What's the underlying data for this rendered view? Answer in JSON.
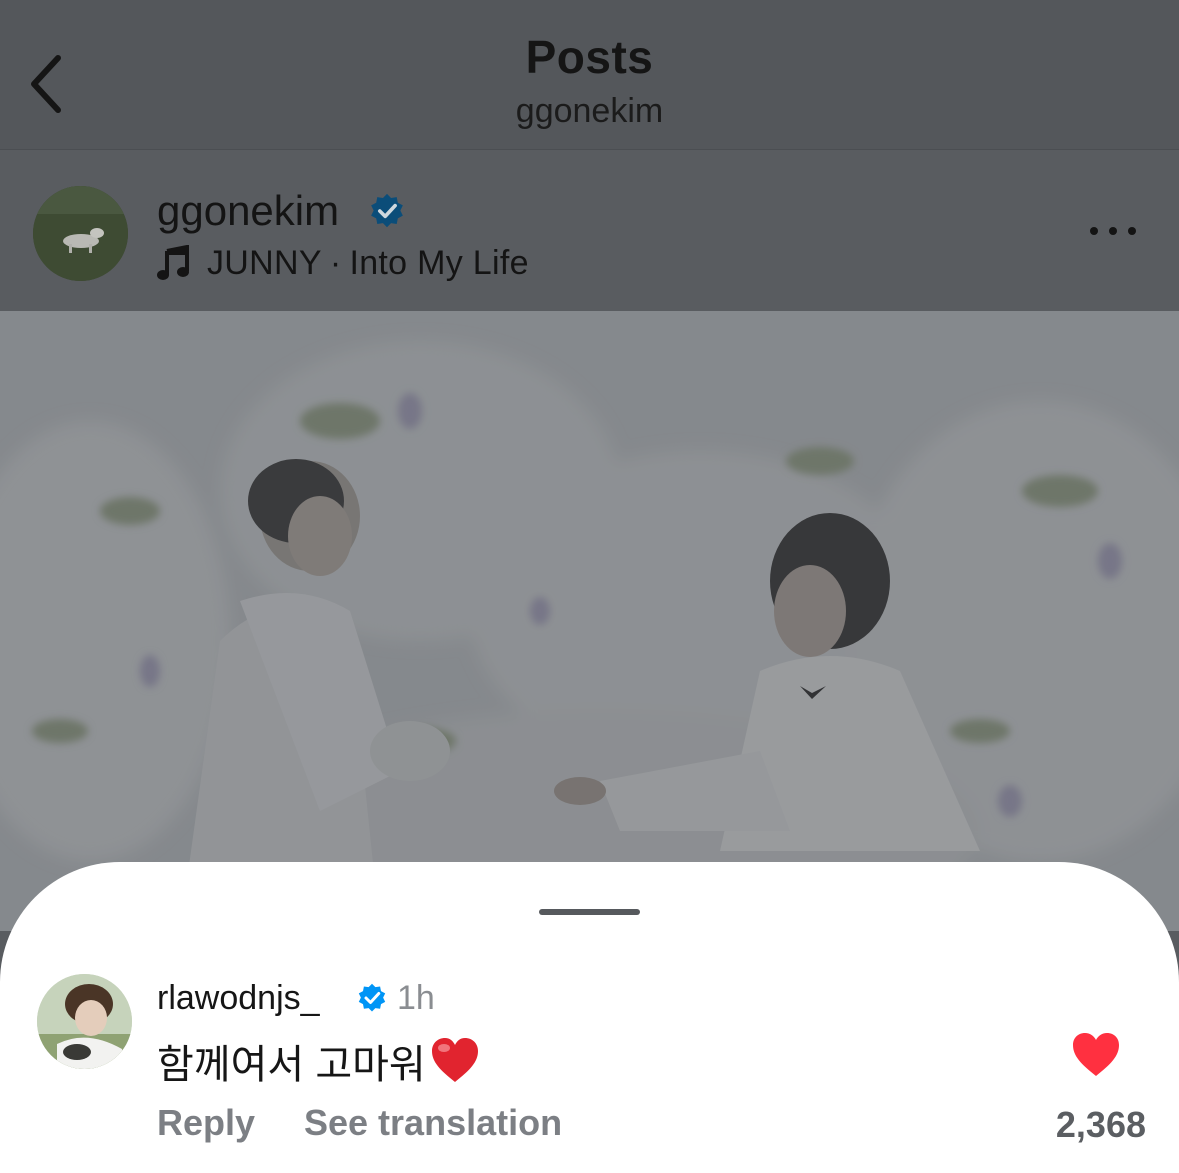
{
  "nav": {
    "title": "Posts",
    "subtitle": "ggonekim",
    "back_icon": "chevron-left-icon"
  },
  "post": {
    "username": "ggonekim",
    "verified": true,
    "music": {
      "artist": "JUNNY",
      "separator": "·",
      "song": "Into My Life"
    },
    "more_icon": "ellipsis-icon"
  },
  "comment": {
    "username": "rlawodnjs_",
    "verified": true,
    "time": "1h",
    "text": "함께여서 고마워",
    "emoji": "red-heart",
    "reply_label": "Reply",
    "translate_label": "See translation",
    "like_count": "2,368",
    "liked": true
  },
  "colors": {
    "verified_blue": "#0095f6",
    "like_red": "#ff3040",
    "overlay_dim": "#595c60"
  }
}
